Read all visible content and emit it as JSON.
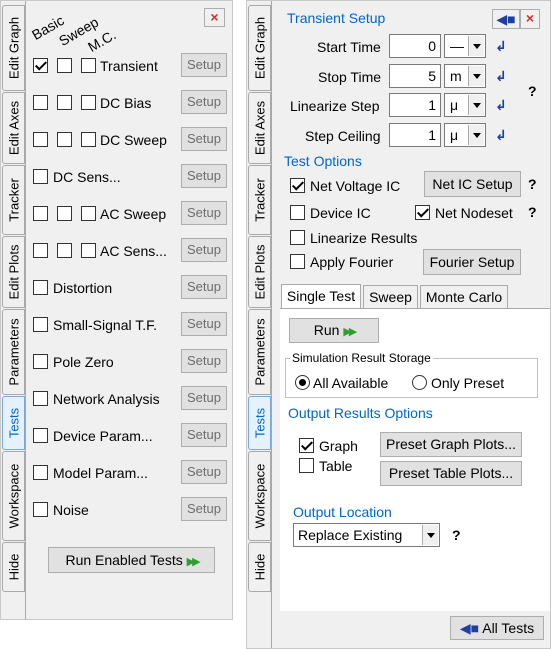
{
  "left": {
    "tabs": [
      "Edit Graph",
      "Edit Axes",
      "Tracker",
      "Edit Plots",
      "Parameters",
      "Tests",
      "Workspace",
      "Hide"
    ],
    "active_tab": "Tests",
    "close_glyph": "×",
    "column_headers": [
      "Basic",
      "Sweep",
      "M.C."
    ],
    "tests": [
      {
        "label": "Transient",
        "basic": true,
        "cols": 3
      },
      {
        "label": "DC Bias",
        "basic": false,
        "cols": 3
      },
      {
        "label": "DC Sweep",
        "basic": false,
        "cols": 3
      },
      {
        "label": "DC Sens...",
        "basic": false,
        "cols": 1
      },
      {
        "label": "AC Sweep",
        "basic": false,
        "cols": 3
      },
      {
        "label": "AC Sens...",
        "basic": false,
        "cols": 3
      },
      {
        "label": "Distortion",
        "basic": false,
        "cols": 1
      },
      {
        "label": "Small-Signal T.F.",
        "basic": false,
        "cols": 1
      },
      {
        "label": "Pole Zero",
        "basic": false,
        "cols": 1
      },
      {
        "label": "Network  Analysis",
        "basic": false,
        "cols": 1
      },
      {
        "label": "Device Param...",
        "basic": false,
        "cols": 1
      },
      {
        "label": "Model  Param...",
        "basic": false,
        "cols": 1
      },
      {
        "label": "Noise",
        "basic": false,
        "cols": 1
      }
    ],
    "setup_label": "Setup",
    "run_enabled_label": "Run Enabled Tests",
    "run_icon": "double-right-arrow-icon"
  },
  "right": {
    "tabs": [
      "Edit Graph",
      "Edit Axes",
      "Tracker",
      "Edit Plots",
      "Parameters",
      "Tests",
      "Workspace",
      "Hide"
    ],
    "active_tab": "Tests",
    "close_glyph": "×",
    "transient_setup": {
      "title": "Transient Setup",
      "start_time": {
        "label": "Start Time",
        "value": "0",
        "unit": "—"
      },
      "stop_time": {
        "label": "Stop Time",
        "value": "5",
        "unit": "m"
      },
      "linearize_step": {
        "label": "Linearize Step",
        "value": "1",
        "unit": "μ"
      },
      "step_ceiling": {
        "label": "Step Ceiling",
        "value": "1",
        "unit": "μ"
      },
      "help": "?"
    },
    "test_options": {
      "title": "Test Options",
      "net_voltage_ic": {
        "label": "Net Voltage IC",
        "checked": true
      },
      "net_ic_setup": "Net IC Setup",
      "device_ic": {
        "label": "Device IC",
        "checked": false
      },
      "net_nodeset": {
        "label": "Net Nodeset",
        "checked": true
      },
      "linearize_results": {
        "label": "Linearize Results",
        "checked": false
      },
      "apply_fourier": {
        "label": "Apply Fourier",
        "checked": false
      },
      "fourier_setup": "Fourier Setup",
      "help": "?"
    },
    "run_tabs": [
      "Single Test",
      "Sweep",
      "Monte Carlo"
    ],
    "active_run_tab": "Single Test",
    "run_label": "Run",
    "storage": {
      "title": "Simulation Result Storage",
      "all_available": "All Available",
      "only_preset": "Only Preset",
      "selected": "All Available"
    },
    "output_options": {
      "title": "Output Results Options",
      "graph": {
        "label": "Graph",
        "checked": true
      },
      "table": {
        "label": "Table",
        "checked": false
      },
      "preset_graph": "Preset Graph Plots...",
      "preset_table": "Preset Table Plots..."
    },
    "output_location": {
      "title": "Output Location",
      "value": "Replace Existing",
      "help": "?"
    },
    "all_tests_label": "All Tests",
    "colors": {
      "accent": "#0066cc",
      "run_arrow": "#2e9e2e",
      "close": "#d0312d",
      "nav_arrow": "#1f3fa0"
    }
  }
}
